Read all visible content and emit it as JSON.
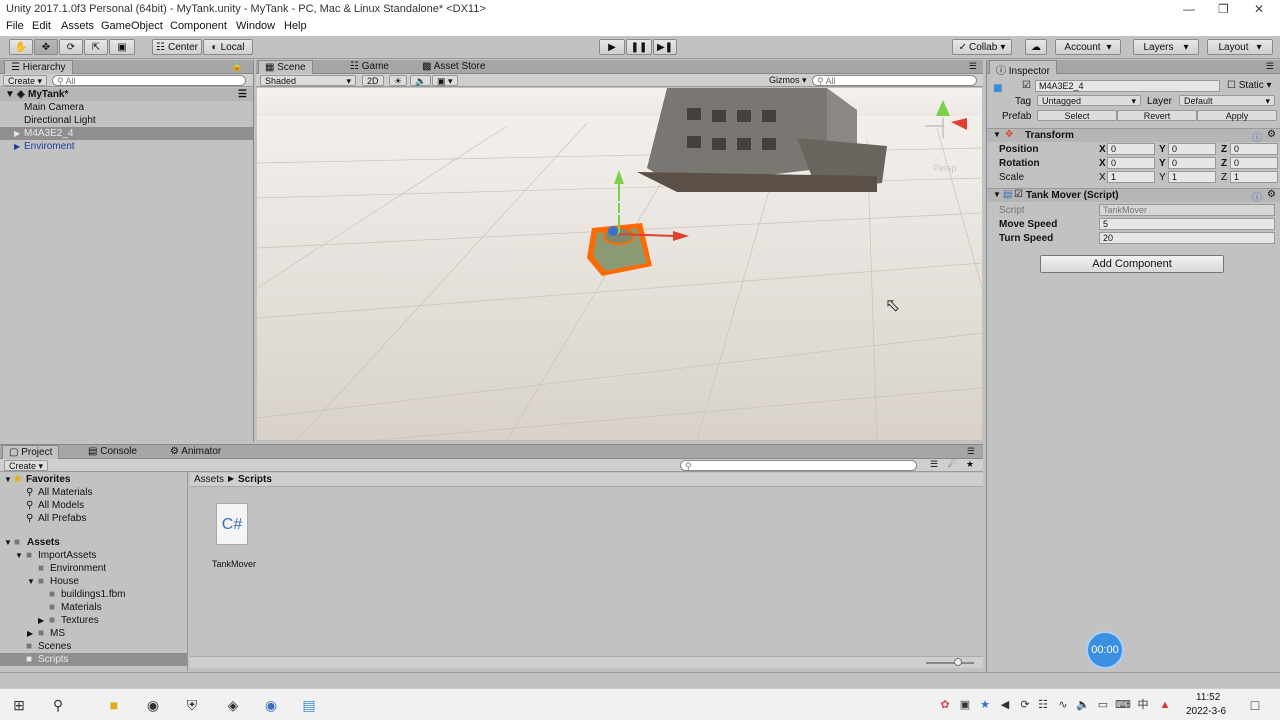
{
  "window": {
    "title": "Unity 2017.1.0f3 Personal (64bit) - MyTank.unity - MyTank - PC, Mac & Linux Standalone* <DX11>"
  },
  "menu": [
    "File",
    "Edit",
    "Assets",
    "GameObject",
    "Component",
    "Window",
    "Help"
  ],
  "toolbar": {
    "center": "Center",
    "local": "Local",
    "collab": "Collab",
    "account": "Account",
    "layers": "Layers",
    "layout": "Layout"
  },
  "hierarchy": {
    "tab": "Hierarchy",
    "create": "Create",
    "search_placeholder": "All",
    "scene": "MyTank*",
    "items": [
      "Main Camera",
      "Directional Light",
      "M4A3E2_4",
      "Enviroment"
    ]
  },
  "scene": {
    "tabs": [
      "Scene",
      "Game",
      "Asset Store"
    ],
    "shading": "Shaded",
    "mode2d": "2D",
    "gizmos": "Gizmos",
    "search_placeholder": "All",
    "persp": "Persp"
  },
  "inspector": {
    "tab": "Inspector",
    "object_name": "M4A3E2_4",
    "static": "Static",
    "tag_label": "Tag",
    "tag": "Untagged",
    "layer_label": "Layer",
    "layer": "Default",
    "prefab_label": "Prefab",
    "select": "Select",
    "revert": "Revert",
    "apply": "Apply",
    "transform": {
      "title": "Transform",
      "position_label": "Position",
      "position": [
        "0",
        "0",
        "0"
      ],
      "rotation_label": "Rotation",
      "rotation": [
        "0",
        "0",
        "0"
      ],
      "scale_label": "Scale",
      "scale": [
        "1",
        "1",
        "1"
      ]
    },
    "script": {
      "title": "Tank Mover (Script)",
      "script_label": "Script",
      "script_value": "TankMover",
      "move_speed_label": "Move Speed",
      "move_speed": "5",
      "turn_speed_label": "Turn Speed",
      "turn_speed": "20"
    },
    "add_component": "Add Component",
    "axis": {
      "x": "X",
      "y": "Y",
      "z": "Z"
    }
  },
  "project": {
    "tabs": [
      "Project",
      "Console",
      "Animator"
    ],
    "create": "Create",
    "breadcrumb": [
      "Assets",
      "Scripts"
    ],
    "favorites": {
      "title": "Favorites",
      "items": [
        "All Materials",
        "All Models",
        "All Prefabs"
      ]
    },
    "assets": {
      "title": "Assets",
      "items": [
        "ImportAssets",
        "Environment",
        "House",
        "buildings1.fbm",
        "Materials",
        "Textures",
        "MS",
        "Scenes",
        "Scripts"
      ]
    },
    "file": "TankMover",
    "file_icon": "C#"
  },
  "overlay": {
    "timer": "00:00"
  },
  "taskbar": {
    "time": "11:52",
    "date": "2022-3-6",
    "ime": "中"
  },
  "colors": {
    "accent": "#1a3f9e",
    "selection": "#8f8f8f",
    "timer": "#3b8fe0",
    "selected_object": "#ff6a00"
  }
}
